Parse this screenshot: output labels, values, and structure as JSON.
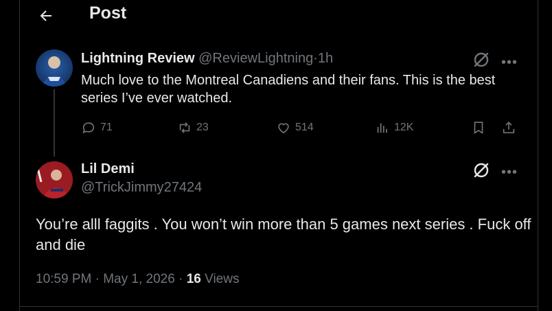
{
  "header": {
    "title": "Post"
  },
  "parent_post": {
    "display_name": "Lightning Review",
    "handle": "@ReviewLightning",
    "separator": "·",
    "time": "1h",
    "text": "Much love to the Montreal Canadiens and their fans. This is the best series I’ve ever watched.",
    "stats": {
      "replies": "71",
      "reposts": "23",
      "likes": "514",
      "views": "12K"
    }
  },
  "reply_post": {
    "display_name": "Lil Demi",
    "handle": "@TrickJimmy27424",
    "text": "You’re alll faggits . You won’t win more than 5 games next series . Fuck off and die",
    "time": "10:59 PM",
    "date": "May 1, 2026",
    "separator": "·",
    "views_count": "16",
    "views_label": "Views"
  },
  "icons": {
    "back": "arrow-left-icon",
    "grok": "grok-icon",
    "more": "more-icon",
    "reply": "reply-icon",
    "repost": "repost-icon",
    "like": "heart-icon",
    "views": "bar-chart-icon",
    "bookmark": "bookmark-icon",
    "share": "share-icon"
  }
}
